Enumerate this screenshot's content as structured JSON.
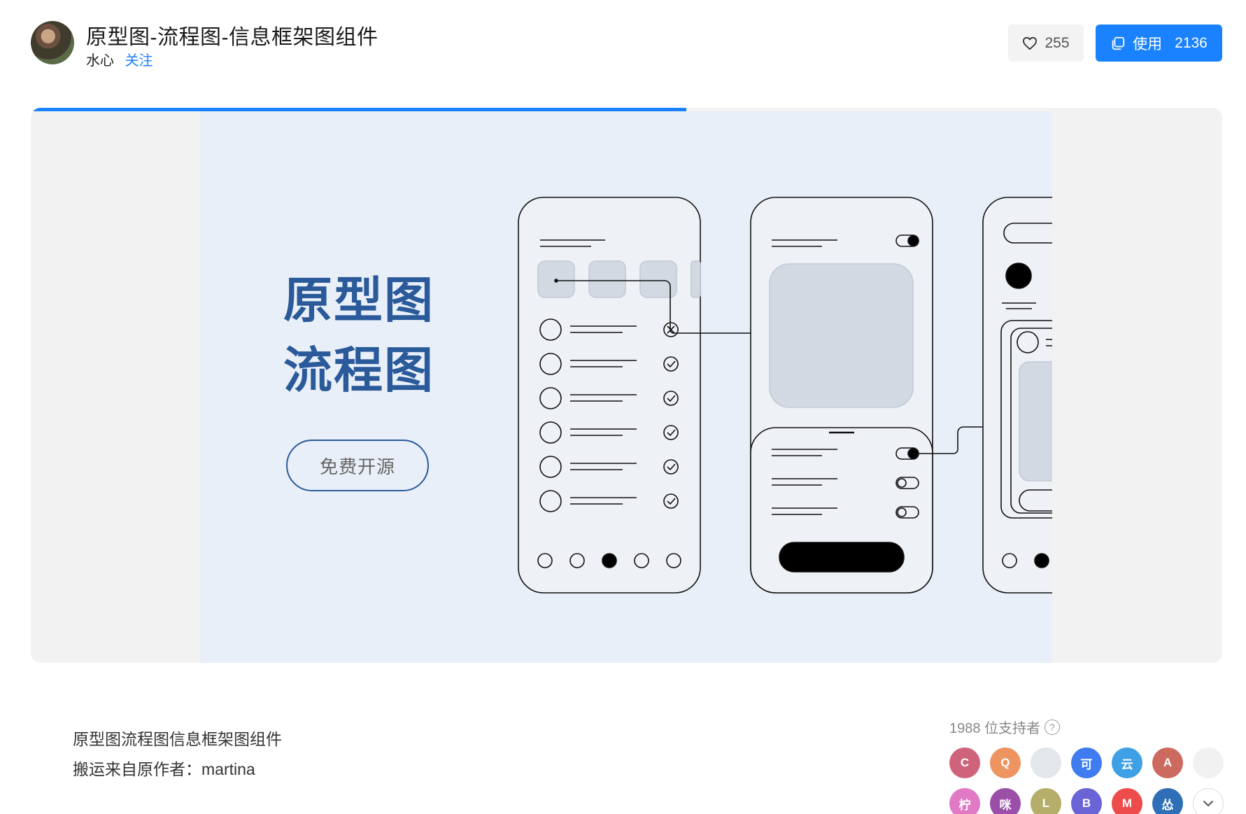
{
  "header": {
    "title": "原型图-流程图-信息框架图组件",
    "author": "水心",
    "follow_label": "关注",
    "like_count": "255",
    "use_label": "使用",
    "use_count": "2136"
  },
  "preview": {
    "progress": 0.55,
    "hero_line1": "原型图",
    "hero_line2": "流程图",
    "hero_button": "免费开源"
  },
  "description": {
    "line1": "原型图流程图信息框架图组件",
    "line2": "搬运来自原作者：martina"
  },
  "supporters": {
    "label": "1988 位支持者",
    "avatars": [
      {
        "letter": "C",
        "color": "#d0637c"
      },
      {
        "letter": "Q",
        "color": "#ee9460"
      },
      {
        "letter": "",
        "color": "#e3e7ec"
      },
      {
        "letter": "可",
        "color": "#3f7cf0"
      },
      {
        "letter": "云",
        "color": "#3fa0e6"
      },
      {
        "letter": "A",
        "color": "#cc6a5f"
      },
      {
        "letter": "",
        "color": "#f1f1f1"
      },
      {
        "letter": "柠",
        "color": "#e179c4"
      },
      {
        "letter": "咪",
        "color": "#9b4fa8"
      },
      {
        "letter": "L",
        "color": "#b4ae6a"
      },
      {
        "letter": "B",
        "color": "#6a64d6"
      },
      {
        "letter": "M",
        "color": "#ee4b4b"
      },
      {
        "letter": "怂",
        "color": "#2e6fb8"
      }
    ]
  },
  "colors": {
    "accent": "#1a82ff",
    "hero_text": "#2a5a9a",
    "slide_bg": "#e9eff8"
  }
}
